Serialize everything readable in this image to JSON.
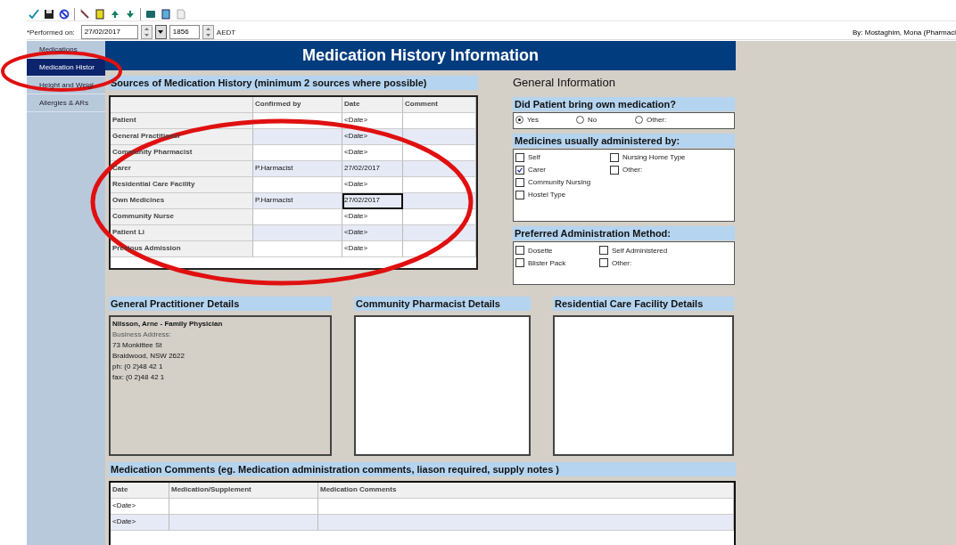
{
  "performed": {
    "label": "*Performed on:",
    "date": "27/02/2017",
    "time": "1856",
    "zone": "AEDT",
    "by": "By:  Mostaghim, Mona (Pharmaci"
  },
  "nav": [
    {
      "label": "Medications",
      "selected": false
    },
    {
      "label": "Medication Histor",
      "selected": true
    },
    {
      "label": "Height and Weigl",
      "selected": false
    },
    {
      "label": "Allergies & ARs",
      "selected": false
    }
  ],
  "title": "Medication History Information",
  "sources": {
    "header": "Sources of Medication History (minimum 2 sources where possible)",
    "columns": [
      "Confirmed by",
      "Date",
      "Comment"
    ],
    "rows": [
      {
        "source": "Patient",
        "confirmed_by": "",
        "date": "<Date>",
        "focused": false
      },
      {
        "source": "General Practitioner",
        "confirmed_by": "",
        "date": "<Date>",
        "focused": false
      },
      {
        "source": "Community Pharmacist",
        "confirmed_by": "",
        "date": "<Date>",
        "focused": false
      },
      {
        "source": "Carer",
        "confirmed_by": "P.Harmacist",
        "date": "27/02/2017",
        "focused": false
      },
      {
        "source": "Residential Care Facility",
        "confirmed_by": "",
        "date": "<Date>",
        "focused": false
      },
      {
        "source": "Own Medicines",
        "confirmed_by": "P.Harmacist",
        "date": "27/02/2017",
        "focused": true
      },
      {
        "source": "Community Nurse",
        "confirmed_by": "",
        "date": "<Date>",
        "focused": false
      },
      {
        "source": "Patient Li",
        "confirmed_by": "",
        "date": "<Date>",
        "focused": false
      },
      {
        "source": "Previous Admission",
        "confirmed_by": "",
        "date": "<Date>",
        "focused": false
      }
    ]
  },
  "general_info": {
    "title": "General Information",
    "own_medication": {
      "header": "Did Patient bring own medication?",
      "options": [
        {
          "label": "Yes",
          "selected": true
        },
        {
          "label": "No",
          "selected": false
        },
        {
          "label": "Other:",
          "selected": false
        }
      ]
    },
    "administered_by": {
      "header": "Medicines usually administered by:",
      "options": [
        {
          "label": "Self",
          "checked": false
        },
        {
          "label": "Carer",
          "checked": true
        },
        {
          "label": "Community Nursing",
          "checked": false
        },
        {
          "label": "Hostel Type",
          "checked": false
        },
        {
          "label": "Nursing Home Type",
          "checked": false
        },
        {
          "label": "Other:",
          "checked": false
        }
      ]
    },
    "administration_method": {
      "header": "Preferred Administration Method:",
      "options": [
        {
          "label": "Dosette",
          "checked": false
        },
        {
          "label": "Blister Pack",
          "checked": false
        },
        {
          "label": "Self Administered",
          "checked": false
        },
        {
          "label": "Other:",
          "checked": false
        }
      ]
    }
  },
  "details": [
    {
      "header": "General Practitioner Details",
      "lines": [
        {
          "kind": "name",
          "text": "Nilsson, Arne - Family Physician"
        },
        {
          "kind": "label",
          "text": "Business Address:"
        },
        {
          "kind": "text",
          "text": "73 Monkittee St"
        },
        {
          "kind": "text",
          "text": "Braidwood, NSW  2622"
        },
        {
          "kind": "text",
          "text": "ph: (0 2)48 42 1"
        },
        {
          "kind": "text",
          "text": "fax: (0 2)48 42 1"
        }
      ]
    },
    {
      "header": "Community Pharmacist Details"
    },
    {
      "header": "Residential Care Facility Details"
    }
  ],
  "comments": {
    "header": "Medication Comments (eg. Medication administration comments, liason required, supply notes )",
    "columns": [
      "Date",
      "Medication/Supplement",
      "Medication Comments"
    ],
    "rows": [
      {
        "date": "<Date>"
      },
      {
        "date": "<Date>"
      }
    ]
  }
}
